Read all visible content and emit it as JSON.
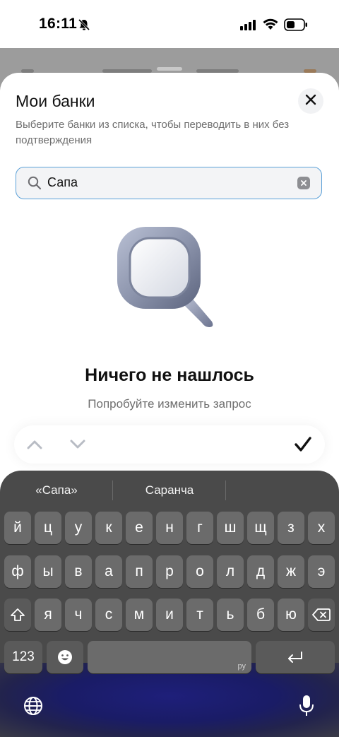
{
  "status_bar": {
    "time": "16:11"
  },
  "sheet": {
    "title": "Мои банки",
    "subtitle": "Выберите банки из списка, чтобы переводить в них без подтверждения"
  },
  "search": {
    "value": "Сапа"
  },
  "empty_state": {
    "title": "Ничего не нашлось",
    "subtitle": "Попробуйте изменить запрос"
  },
  "keyboard": {
    "suggestions": [
      "«Сапа»",
      "Саранча",
      ""
    ],
    "rows": [
      [
        "й",
        "ц",
        "у",
        "к",
        "е",
        "н",
        "г",
        "ш",
        "щ",
        "з",
        "х"
      ],
      [
        "ф",
        "ы",
        "в",
        "а",
        "п",
        "р",
        "о",
        "л",
        "д",
        "ж",
        "э"
      ],
      [
        "я",
        "ч",
        "с",
        "м",
        "и",
        "т",
        "ь",
        "б",
        "ю"
      ]
    ],
    "numbers_label": "123",
    "space_lang": "ру"
  },
  "icons": {
    "close": "close-icon",
    "search": "search-icon",
    "clear": "clear-icon",
    "up": "chevron-up-icon",
    "down": "chevron-down-icon",
    "done": "checkmark-icon",
    "shift": "shift-icon",
    "backspace": "backspace-icon",
    "emoji": "emoji-icon",
    "return": "return-icon",
    "globe": "globe-icon",
    "mic": "microphone-icon"
  },
  "colors": {
    "accent_border": "#5aa0d8",
    "keyboard_bg": "#4a4a4a",
    "key_bg": "#6b6b6b"
  }
}
